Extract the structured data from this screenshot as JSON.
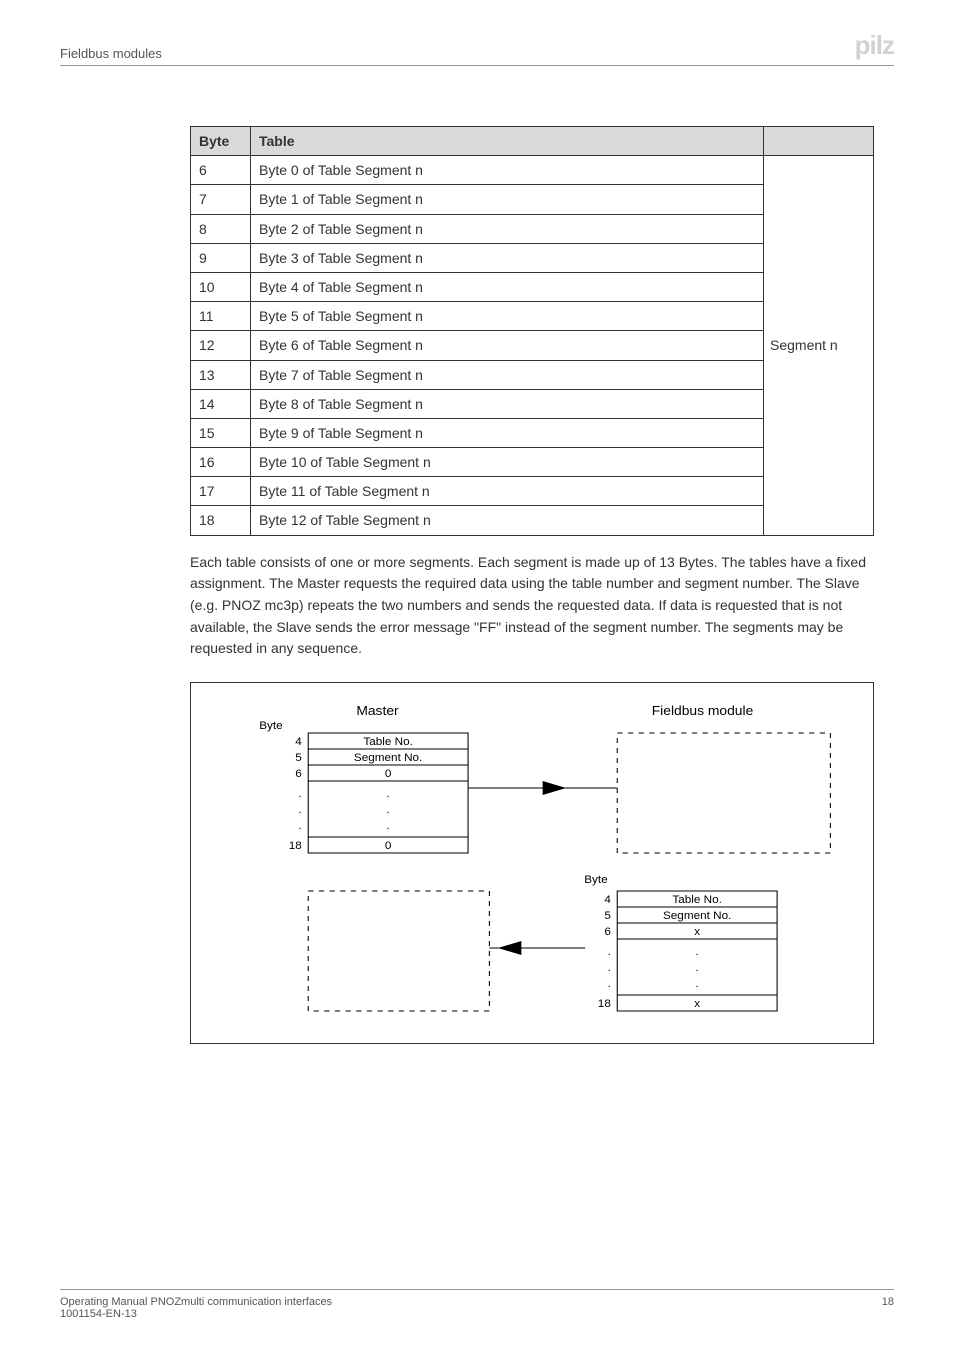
{
  "header": {
    "breadcrumb": "Fieldbus modules",
    "logo_main": "pilz",
    "logo_dot": "●"
  },
  "table": {
    "head_byte": "Byte",
    "head_table": "Table",
    "segment_label": "Segment n",
    "rows": [
      {
        "byte": "6",
        "desc": "Byte 0 of Table Segment n"
      },
      {
        "byte": "7",
        "desc": "Byte 1 of Table Segment n"
      },
      {
        "byte": "8",
        "desc": "Byte 2 of Table Segment n"
      },
      {
        "byte": "9",
        "desc": "Byte 3 of Table Segment n"
      },
      {
        "byte": "10",
        "desc": "Byte 4 of Table Segment n"
      },
      {
        "byte": "11",
        "desc": "Byte 5 of Table Segment n"
      },
      {
        "byte": "12",
        "desc": "Byte 6 of Table Segment n"
      },
      {
        "byte": "13",
        "desc": "Byte 7 of Table Segment n"
      },
      {
        "byte": "14",
        "desc": "Byte 8 of Table Segment n"
      },
      {
        "byte": "15",
        "desc": "Byte 9 of Table Segment n"
      },
      {
        "byte": "16",
        "desc": "Byte 10 of Table Segment n"
      },
      {
        "byte": "17",
        "desc": "Byte 11 of Table Segment n"
      },
      {
        "byte": "18",
        "desc": "Byte 12 of Table Segment n"
      }
    ]
  },
  "paragraph": "Each table consists of one or more segments. Each segment is made up of 13 Bytes. The tables have a fixed assignment. The Master requests the required data using the table number and segment number. The Slave (e.g. PNOZ mc3p) repeats the two numbers and sends the requested data. If data is requested that is not available, the Slave sends the error message \"FF\" instead of the segment number. The segments may be requested in any sequence.",
  "diagram": {
    "master_label": "Master",
    "fieldbus_label": "Fieldbus module",
    "byte_label": "Byte",
    "master_rows": {
      "b4": "4",
      "b5": "5",
      "b6": "6",
      "bdots": ".",
      "b18": "18",
      "r4": "Table No.",
      "r5": "Segment No.",
      "r6": "0",
      "rdots": ".",
      "r18": "0"
    },
    "fieldbus_rows": {
      "b4": "4",
      "b5": "5",
      "b6": "6",
      "bdots": ".",
      "b18": "18",
      "r4": "Table No.",
      "r5": "Segment No.",
      "r6": "x",
      "rdots": ".",
      "r18": "x"
    }
  },
  "footer": {
    "line1": "Operating Manual PNOZmulti communication interfaces",
    "line2": "1001154-EN-13",
    "page": "18"
  }
}
